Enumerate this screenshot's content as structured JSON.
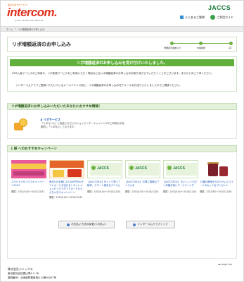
{
  "header": {
    "logo_tagline": "毎日の幸せサービス",
    "logo_text": "intercom.",
    "logo_sub": "JACCS INTERCOM SERVICE",
    "brand": "JACCS",
    "links": [
      {
        "label": "よくあるご質問",
        "icon": "square-icon"
      },
      {
        "label": "ご利用ガイド",
        "icon": "guide-icon"
      }
    ]
  },
  "breadcrumb": {
    "home": "ホーム",
    "sep": ">",
    "current": "リボ増額返済のお申し込み"
  },
  "title": {
    "text": "リボ増額返済のお申し込み",
    "steps": [
      {
        "label": "増額返済金額入力",
        "done": true
      },
      {
        "label": "内容確認",
        "done": true
      },
      {
        "label": "完了",
        "done": true
      }
    ]
  },
  "message": {
    "heading": "リボ増額返済のお申し込みを受け付けいたしました。",
    "line1": "ATM入金サービスのご利用や、リボ変更サービスをご利用いただく場合などはリボ増額返済のお申し込みを取り消させていただくことがございます。あらかじめご了承ください。",
    "line2": "インターコムクラブご登録いただいているメールアドレス宛に、リボ増額返済のお申し込み完了メールをお送りいたしましたのでご確認ください。"
  },
  "recommend": {
    "heading": "リボ増額返済にお申し込みいただいたあなたにおすすめ情報！",
    "title": "リボサービス",
    "desc": "「リボらいふ」と指定いただいたショッピング・キャッシングのご利用分が自動的に「リボ払い」となります。"
  },
  "campaign": {
    "heading": "[ 様 へのおすすめキャンペーン",
    "cards": [
      {
        "desc": "スペシャルサンクスキャンペーン2013",
        "date": "期間：2013/10/1～2013/12/31"
      },
      {
        "desc": "毎月100名様に10,000円分のギフトカードが当たる！ネットショッピングでギフトカードもらえちゃおうキャンペーン",
        "date": "期間：2013/10/1～2013/12/31"
      },
      {
        "desc": "【JACCS本キ】ゆっくり寄って乾杯。スマート感あるアイテム",
        "date": "期間：2013/10/1～2013/11/24"
      },
      {
        "desc": "【JACCS本キ】 お得に素敵なアイテムを",
        "date": "期間：2013/10/1～2013/11/24"
      },
      {
        "desc": "【JACCS本キ】 おいしくいただく本格お祝いマーケティング",
        "date": "期間：2013/10/1～2013/11/24"
      },
      {
        "desc": "12種の産地からのジャムとスイーツのセットをプレゼント",
        "date": "期間：2013/9/1～2013/11/30"
      }
    ],
    "banner_words": [
      "JACCS",
      "JACCS",
      "JACCS"
    ]
  },
  "buttons": {
    "change_btn": "お支払い方法の変更(リボ払い)",
    "top_btn": "インターコムクラブトップ"
  },
  "pagetop": "page top",
  "footer": {
    "company": "株式会社ジャックス",
    "address": "東京都渋谷区恵比寿4-1-18",
    "registration": "登録番号：北海道財務局長(11)第00007号"
  }
}
